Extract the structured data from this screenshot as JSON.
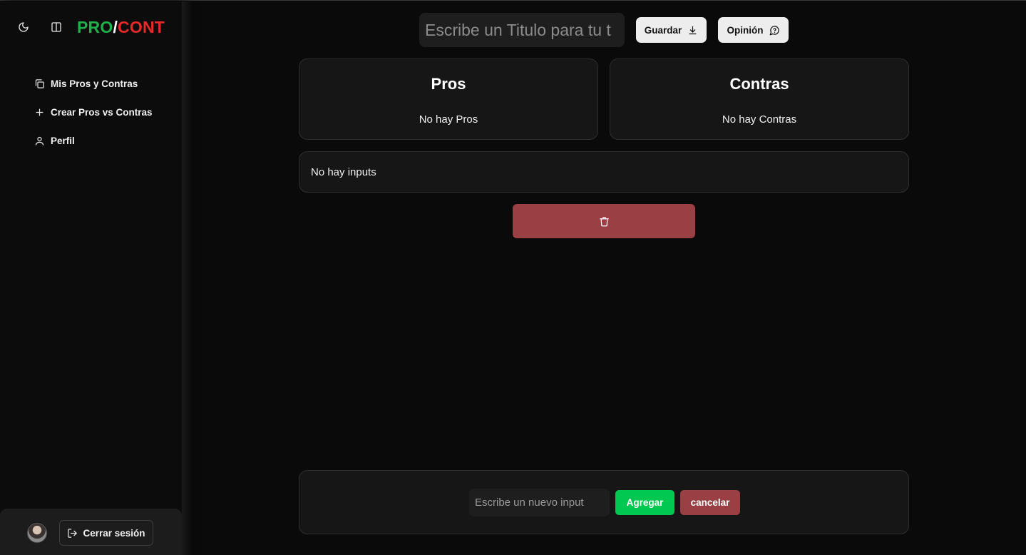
{
  "brand": {
    "pro": "PRO",
    "slash": "/",
    "cont": "CONT"
  },
  "sidebar": {
    "items": [
      {
        "label": "Mis Pros y Contras",
        "icon": "copy-icon"
      },
      {
        "label": "Crear Pros vs Contras",
        "icon": "plus-icon"
      },
      {
        "label": "Perfil",
        "icon": "user-icon"
      }
    ],
    "logout_label": "Cerrar sesión"
  },
  "header": {
    "title_placeholder": "Escribe un Titulo para tu t",
    "save_label": "Guardar",
    "opinion_label": "Opinión"
  },
  "pros": {
    "title": "Pros",
    "empty": "No hay Pros"
  },
  "cons": {
    "title": "Contras",
    "empty": "No hay Contras"
  },
  "inputs": {
    "empty": "No hay inputs"
  },
  "composer": {
    "placeholder": "Escribe un nuevo input",
    "add_label": "Agregar",
    "cancel_label": "cancelar"
  },
  "colors": {
    "pro_green": "#1fb14a",
    "cont_red": "#e62a2a",
    "add_green": "#00c850",
    "danger": "#9a3f43"
  }
}
